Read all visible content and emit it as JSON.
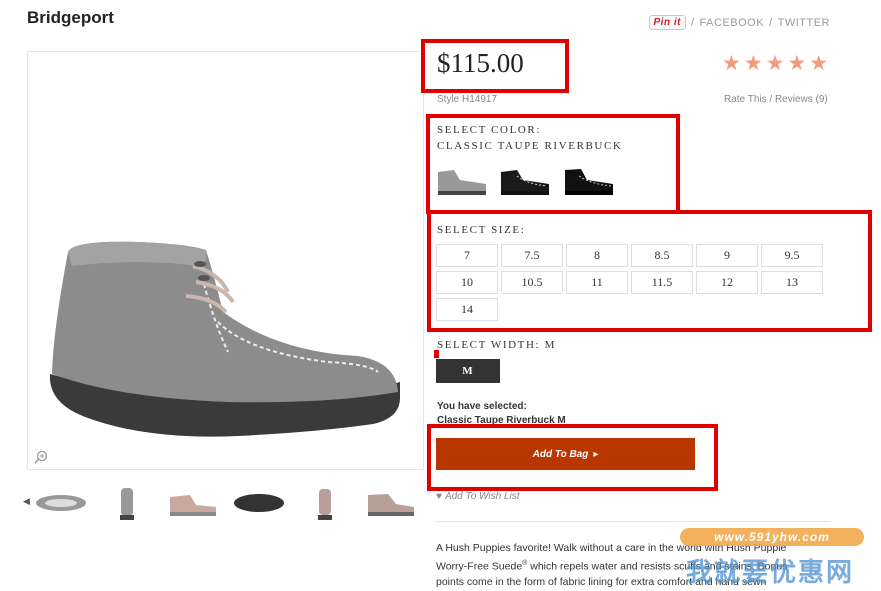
{
  "product": {
    "title": "Bridgeport",
    "price": "$115.00",
    "style": "Style H14917",
    "rating_stars": 5,
    "stars_text": "★★★★★",
    "reviews": "Rate This / Reviews (9)"
  },
  "share": {
    "pinit": "Pin it",
    "sep1": "/",
    "facebook": "FACEBOOK",
    "sep2": "/",
    "twitter": "TWITTER"
  },
  "color": {
    "label": "SELECT COLOR:",
    "selected": "CLASSIC TAUPE RIVERBUCK",
    "swatches": [
      "grey-suede-shoe",
      "black-leather-shoe",
      "black-leather-shoe-alt"
    ]
  },
  "size": {
    "label": "SELECT SIZE:",
    "options": [
      "7",
      "7.5",
      "8",
      "8.5",
      "9",
      "9.5",
      "10",
      "10.5",
      "11",
      "11.5",
      "12",
      "13",
      "14"
    ]
  },
  "width": {
    "label": "SELECT WIDTH:",
    "value": "M",
    "button": "M"
  },
  "selection": {
    "label": "You have selected:",
    "value": "Classic Taupe Riverbuck M"
  },
  "actions": {
    "add_to_bag": "Add To Bag",
    "wishlist": "Add To Wish List"
  },
  "description": {
    "line1": "A Hush Puppies favorite! Walk without a care in the world with Hush Puppie",
    "line2a": "Worry-Free Suede",
    "line2sup": "®",
    "line2b": " which repels water and resists scuffs and stains. Bonus",
    "line3": "points come in the form of fabric lining for extra comfort and hand sewn"
  },
  "watermark": {
    "url": "www.591yhw.com",
    "text": "我就要优惠网"
  },
  "colors": {
    "accent_red": "#e10000",
    "bag_button": "#b83700",
    "stars": "#f29b80"
  }
}
